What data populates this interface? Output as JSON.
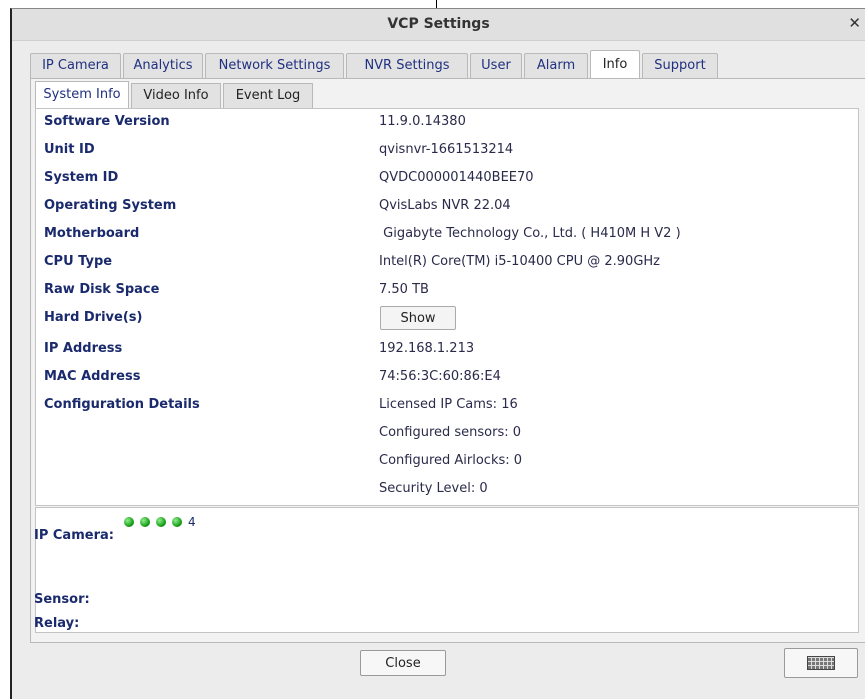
{
  "window": {
    "title": "VCP Settings",
    "close_glyph": "✕"
  },
  "tabs": [
    {
      "label": "IP Camera",
      "active": false
    },
    {
      "label": "Analytics",
      "active": false
    },
    {
      "label": "Network Settings",
      "active": false
    },
    {
      "label": "NVR Settings",
      "active": false
    },
    {
      "label": "User",
      "active": false
    },
    {
      "label": "Alarm",
      "active": false
    },
    {
      "label": "Info",
      "active": true
    },
    {
      "label": "Support",
      "active": false
    }
  ],
  "subtabs": [
    {
      "label": "System Info",
      "active": true
    },
    {
      "label": "Video Info",
      "active": false
    },
    {
      "label": "Event Log",
      "active": false
    }
  ],
  "system_info": [
    {
      "label": "Software Version",
      "value": "11.9.0.14380"
    },
    {
      "label": "Unit ID",
      "value": "qvisnvr-1661513214"
    },
    {
      "label": "System ID",
      "value": "QVDC000001440BEE70"
    },
    {
      "label": "Operating System",
      "value": "QvisLabs NVR 22.04"
    },
    {
      "label": "Motherboard",
      "value": " Gigabyte Technology Co., Ltd. ( H410M H V2 )"
    },
    {
      "label": "CPU Type",
      "value": "Intel(R) Core(TM) i5-10400 CPU @ 2.90GHz"
    },
    {
      "label": "Raw Disk Space",
      "value": "7.50 TB"
    },
    {
      "label": "Hard Drive(s)",
      "value": ""
    },
    {
      "label": "IP Address",
      "value": "192.168.1.213"
    },
    {
      "label": "MAC Address",
      "value": "74:56:3C:60:86:E4"
    },
    {
      "label": "Configuration Details",
      "value": "Licensed IP Cams: 16"
    },
    {
      "label": "",
      "value": "Configured sensors: 0"
    },
    {
      "label": "",
      "value": "Configured Airlocks: 0"
    },
    {
      "label": "",
      "value": "Security Level: 0"
    }
  ],
  "hard_drive_button": "Show",
  "status": {
    "ip_camera_label": "IP Camera:",
    "ip_camera_count": "4",
    "ip_camera_dot_color": "#19a019",
    "sensor_label": "Sensor:",
    "relay_label": "Relay:"
  },
  "footer": {
    "close_label": "Close",
    "keyboard_icon": "keyboard-icon"
  }
}
